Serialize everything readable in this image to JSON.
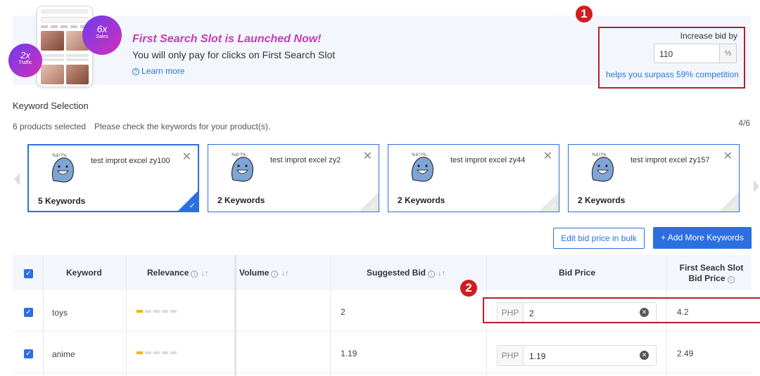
{
  "banner": {
    "bubble_sales_big": "6x",
    "bubble_sales_small": "Sales",
    "bubble_traffic_big": "2x",
    "bubble_traffic_small": "Traffic",
    "headline": "First Search Slot is Launched Now!",
    "subline": "You will only pay for clicks on First Search Slot",
    "learn_more": "Learn more",
    "callout_1": "1",
    "increase_bid_label": "Increase bid by",
    "increase_bid_value": "110",
    "increase_bid_unit": "%",
    "surpass_text": "helps you surpass 59% competition"
  },
  "keyword_selection": {
    "title": "Keyword Selection",
    "selected_count": "6 products selected",
    "instruction": "Please check the keywords for your product(s).",
    "page_count": "4/6",
    "products": [
      {
        "name": "test improt excel zy100",
        "keywords": "5 Keywords",
        "active": true
      },
      {
        "name": "test improt excel zy2",
        "keywords": "2 Keywords",
        "active": false
      },
      {
        "name": "test improt excel zy44",
        "keywords": "2 Keywords",
        "active": false
      },
      {
        "name": "test improt excel zy157",
        "keywords": "2 Keywords",
        "active": false
      }
    ],
    "edit_bulk_label": "Edit bid price in bulk",
    "add_keywords_label": "+ Add More Keywords"
  },
  "table": {
    "headers": {
      "keyword": "Keyword",
      "relevance": "Relevance",
      "volume": "Volume",
      "suggested_bid": "Suggested Bid",
      "bid_price": "Bid Price",
      "first_slot_line1": "First Seach Slot",
      "first_slot_line2": "Bid Price"
    },
    "callout_2": "2",
    "currency": "PHP",
    "rows": [
      {
        "keyword": "toys",
        "relevance_level": 1,
        "volume": "",
        "suggested_bid": "2",
        "bid_price": "2",
        "first_slot_bid": "4.2"
      },
      {
        "keyword": "anime",
        "relevance_level": 1,
        "volume": "",
        "suggested_bid": "1.19",
        "bid_price": "1.19",
        "first_slot_bid": "2.49"
      }
    ]
  }
}
